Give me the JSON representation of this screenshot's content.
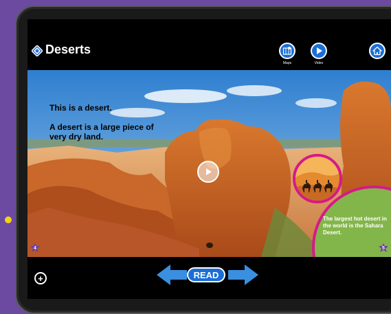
{
  "app": {
    "title": "Deserts",
    "nav": {
      "maps_label": "Maps",
      "video_label": "Video"
    },
    "icons": {
      "logo": "diamond-logo-icon",
      "maps": "map-icon",
      "video": "play-icon",
      "home": "home-icon"
    },
    "colors": {
      "button_blue": "#1b6ed6",
      "accent_magenta": "#d6198a",
      "fact_green": "#83b64a",
      "page_badge_purple": "#6b3fa0"
    }
  },
  "page": {
    "text_line1": "This is a desert.",
    "text_line2": "A desert is a large piece of very dry land.",
    "fact_text": "The largest hot desert in the world is the Sahara Desert.",
    "left_page_number": "4",
    "right_page_number": "5"
  },
  "controls": {
    "read_label": "READ",
    "add_label": "+"
  }
}
